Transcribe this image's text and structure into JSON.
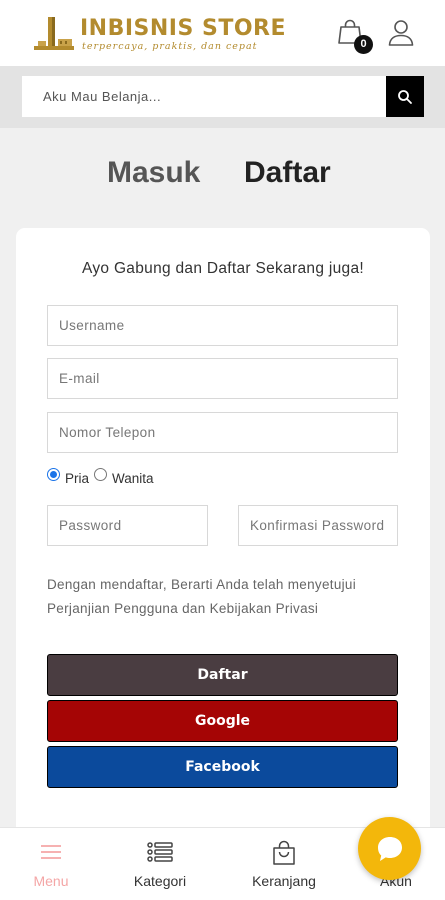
{
  "header": {
    "logo_title": "INBISNIS STORE",
    "logo_tagline": "terpercaya, praktis, dan cepat",
    "cart_count": "0",
    "brand_color": "#b38b2e"
  },
  "search": {
    "placeholder": "Aku Mau Belanja..."
  },
  "tabs": {
    "login": "Masuk",
    "register": "Daftar"
  },
  "form": {
    "heading": "Ayo Gabung dan Daftar Sekarang juga!",
    "username_placeholder": "Username",
    "email_placeholder": "E-mail",
    "phone_placeholder": "Nomor Telepon",
    "gender_options": [
      "Pria",
      "Wanita"
    ],
    "gender_selected": "Pria",
    "password_placeholder": "Password",
    "confirm_placeholder": "Konfirmasi Password",
    "agreement": "Dengan mendaftar, Berarti Anda telah menyetujui Perjanjian Pengguna dan Kebijakan Privasi",
    "register_button": "Daftar",
    "google_button": "Google",
    "facebook_button": "Facebook"
  },
  "bottom_nav": {
    "menu": "Menu",
    "kategori": "Kategori",
    "keranjang": "Keranjang",
    "akun": "Akun"
  },
  "colors": {
    "register_button": "#4a3d41",
    "google_button": "#a50505",
    "facebook_button": "#0b4a9c",
    "chat_button": "#f3b70b"
  }
}
